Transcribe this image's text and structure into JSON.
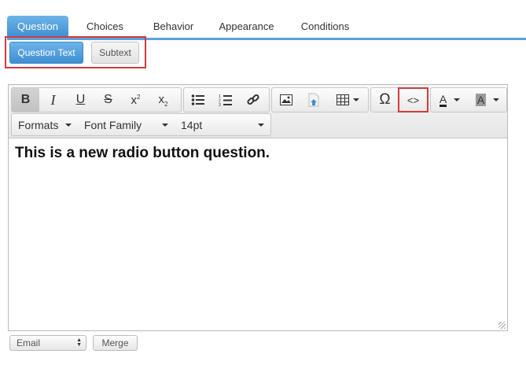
{
  "tabs": [
    {
      "label": "Question"
    },
    {
      "label": "Choices"
    },
    {
      "label": "Behavior"
    },
    {
      "label": "Appearance"
    },
    {
      "label": "Conditions"
    }
  ],
  "subtabs": {
    "question_text": "Question Text",
    "subtext": "Subtext"
  },
  "toolbar": {
    "bold": "B",
    "italic": "I",
    "underline": "U",
    "strike": "S",
    "superscript_base": "x",
    "superscript_mark": "2",
    "subscript_base": "x",
    "subscript_mark": "2",
    "special_char": "Ω",
    "source_code": "<>",
    "text_color": "A",
    "bg_color": "A",
    "formats": "Formats",
    "font_family": "Font Family",
    "font_size": "14pt"
  },
  "editor": {
    "content": "This is a new radio button question."
  },
  "footer": {
    "merge_select_value": "Email",
    "merge_button": "Merge"
  },
  "colors": {
    "accent": "#4a9be0",
    "highlight": "#d63a3a"
  }
}
